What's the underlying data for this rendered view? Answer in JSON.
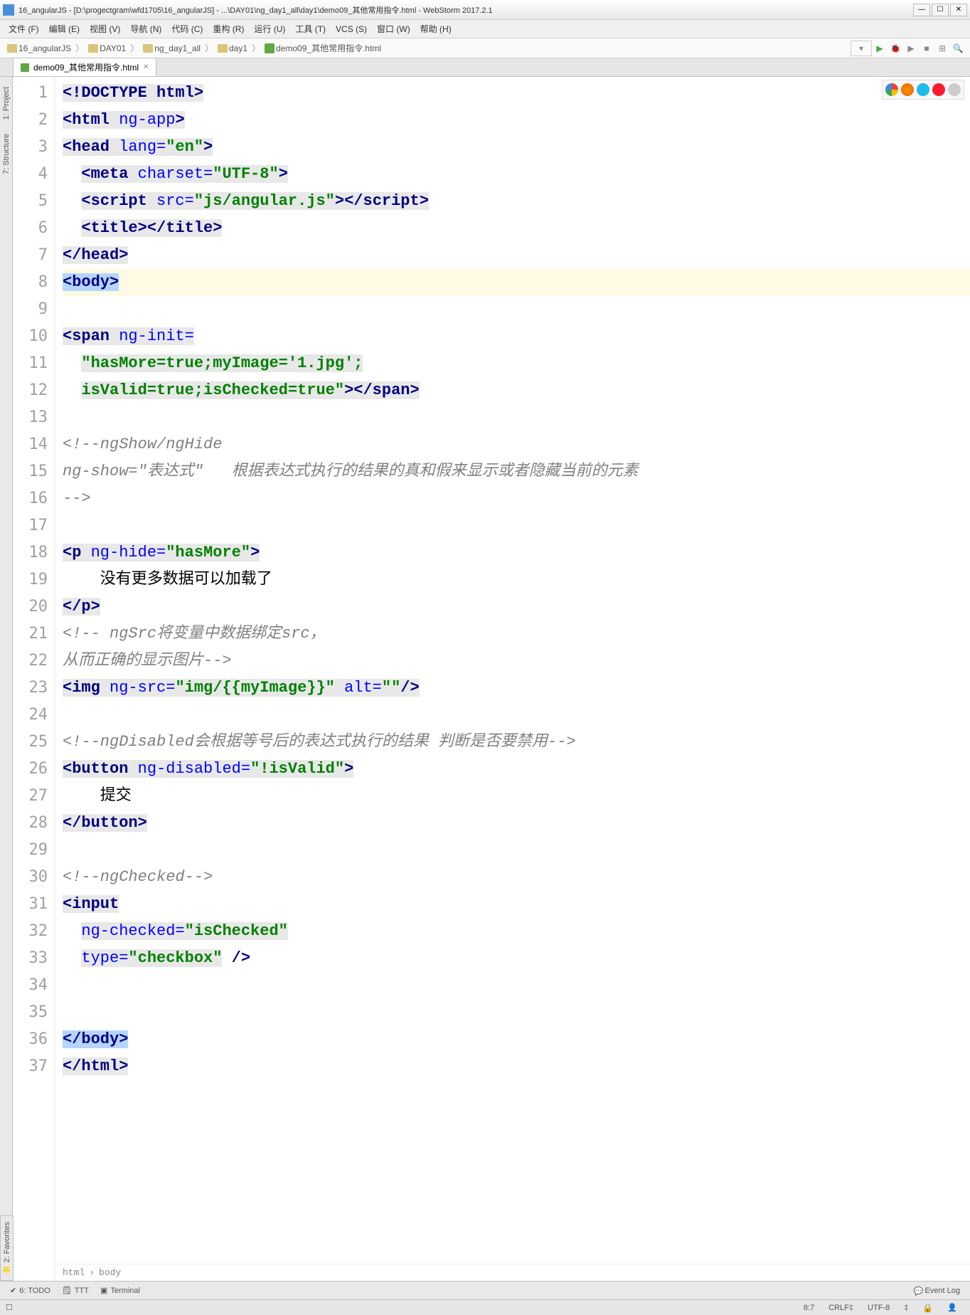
{
  "window": {
    "title": "16_angularJS - [D:\\progectgram\\wfd1705\\16_angularJS] - ...\\DAY01\\ng_day1_all\\day1\\demo09_其他常用指令.html - WebStorm 2017.2.1"
  },
  "menu": {
    "file": "文件 (F)",
    "edit": "编辑 (E)",
    "view": "视图 (V)",
    "nav": "导航 (N)",
    "code": "代码 (C)",
    "refactor": "重构 (R)",
    "run": "运行 (U)",
    "tools": "工具 (T)",
    "vcs": "VCS (S)",
    "window": "窗口 (W)",
    "help": "帮助 (H)"
  },
  "breadcrumb": {
    "b1": "16_angularJS",
    "b2": "DAY01",
    "b3": "ng_day1_all",
    "b4": "day1",
    "b5": "demo09_其他常用指令.html"
  },
  "tab": {
    "name": "demo09_其他常用指令.html"
  },
  "leftTabs": {
    "project": "1: Project",
    "structure": "7: Structure"
  },
  "leftFav": {
    "fav": "2: Favorites"
  },
  "crumbPath": {
    "c1": "html",
    "c2": "body"
  },
  "bottomTools": {
    "todo": "6: TODO",
    "ttt": "TTT",
    "terminal": "Terminal",
    "eventlog": "Event Log"
  },
  "status": {
    "pos": "8:7",
    "le": "CRLF‡",
    "enc": "UTF-8",
    "ins": "‡"
  },
  "code": {
    "lines": [
      "1",
      "2",
      "3",
      "4",
      "5",
      "6",
      "7",
      "8",
      "9",
      "10",
      "11",
      "12",
      "13",
      "14",
      "15",
      "16",
      "17",
      "18",
      "19",
      "20",
      "21",
      "22",
      "23",
      "24",
      "25",
      "26",
      "27",
      "28",
      "29",
      "30",
      "31",
      "32",
      "33",
      "34",
      "35",
      "36",
      "37"
    ],
    "l19": "    没有更多数据可以加载了",
    "l27": "    提交"
  }
}
